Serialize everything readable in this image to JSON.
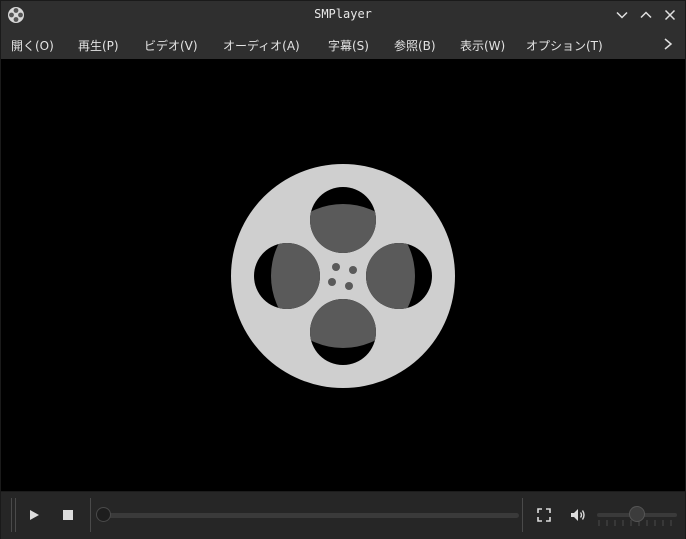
{
  "window": {
    "title": "SMPlayer"
  },
  "menu": {
    "items": [
      {
        "label": "開く(O)"
      },
      {
        "label": "再生(P)"
      },
      {
        "label": "ビデオ(V)"
      },
      {
        "label": "オーディオ(A)"
      },
      {
        "label": "字幕(S)"
      },
      {
        "label": "参照(B)"
      },
      {
        "label": "表示(W)"
      },
      {
        "label": "オプション(T)"
      }
    ]
  },
  "playback": {
    "position_fraction": 0.0,
    "volume_fraction": 0.5
  },
  "colors": {
    "video_background": "#000000",
    "reel_light": "#cfcfcf",
    "reel_dark": "#5a5a5a",
    "chrome": "#2f2f2f"
  }
}
